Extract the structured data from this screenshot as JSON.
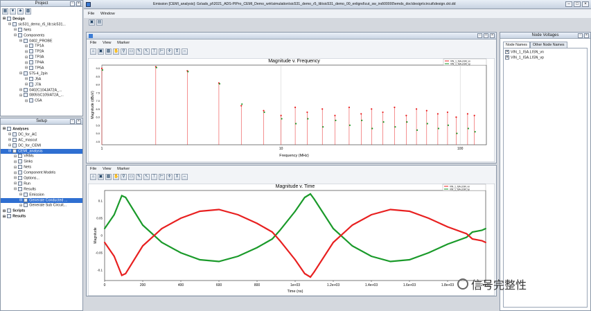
{
  "app": {
    "title": "Emission [CEMI_analysis]: Gs\\ads_pl\\2021_ADS-PIPro_CEMI_Demo_wrk\\simulation\\sic531_demo_r5_lib\\sic531_demo_00_enlignd\\cut_sw_ind\\00000\\emds_doc\\design\\circuit\\design.ckt.dd",
    "menu": [
      "File",
      "Window"
    ]
  },
  "project": {
    "title": "Project",
    "items": [
      {
        "label": "Design",
        "indent": 0,
        "bold": true
      },
      {
        "label": "sic531_demo_r5_lib:sic531...",
        "indent": 1
      },
      {
        "label": "Nets",
        "indent": 2
      },
      {
        "label": "Components",
        "indent": 2
      },
      {
        "label": "0402_PROBE",
        "indent": 3
      },
      {
        "label": "TP1A",
        "indent": 4
      },
      {
        "label": "TP2A",
        "indent": 4
      },
      {
        "label": "TP3A",
        "indent": 4
      },
      {
        "label": "TP4A",
        "indent": 4
      },
      {
        "label": "TP5A",
        "indent": 4
      },
      {
        "label": "575-4_2pin",
        "indent": 3
      },
      {
        "label": "J5A",
        "indent": 4
      },
      {
        "label": "J7A",
        "indent": 4
      },
      {
        "label": "0402C104JAT2A_...",
        "indent": 3
      },
      {
        "label": "0805SC105IAT2A_...",
        "indent": 3
      },
      {
        "label": "C5A",
        "indent": 4
      }
    ]
  },
  "setup": {
    "title": "Setup",
    "items": [
      {
        "label": "Analyses",
        "indent": 0,
        "bold": true
      },
      {
        "label": "DC_for_AC",
        "indent": 1
      },
      {
        "label": "AC_mascut",
        "indent": 1
      },
      {
        "label": "DC_for_CEMI",
        "indent": 1
      },
      {
        "label": "CEMI_analysis",
        "indent": 1,
        "selected": true
      },
      {
        "label": "VRMs",
        "indent": 2
      },
      {
        "label": "Sinks",
        "indent": 2
      },
      {
        "label": "Nets",
        "indent": 2
      },
      {
        "label": "Component Models",
        "indent": 2
      },
      {
        "label": "Options...",
        "indent": 2
      },
      {
        "label": "Run",
        "indent": 2
      },
      {
        "label": "Results",
        "indent": 2
      },
      {
        "label": "Emission",
        "indent": 3
      },
      {
        "label": "Generate Conducted ...",
        "indent": 3,
        "selected": true
      },
      {
        "label": "Generate Sub Circuit...",
        "indent": 3
      },
      {
        "label": "Scripts",
        "indent": 0,
        "bold": true
      },
      {
        "label": "Results",
        "indent": 0,
        "bold": true
      }
    ]
  },
  "plot_menu": [
    "File",
    "View",
    "Marker"
  ],
  "node_voltages": {
    "title": "Node Voltages",
    "tabs": [
      "Node Names",
      "Other Node Names"
    ],
    "items": [
      "VIN_1_ISA.LISN_vn",
      "VIN_1_ISA.LISN_vp"
    ]
  },
  "watermark": "信号完整性",
  "colors": {
    "red": "#e82020",
    "green": "#1a9a2a",
    "select": "#2f6fd1"
  },
  "chart_data": [
    {
      "type": "scatter",
      "title": "Magnitude v. Frequency",
      "xlabel": "Frequency (MHz)",
      "ylabel": "Magnitude (dBuV)",
      "xscale": "log",
      "xticks": [
        "1",
        "10",
        "100"
      ],
      "yticks": [
        "9.0",
        "8.5",
        "8.0",
        "7.5",
        "7.0",
        "6.5",
        "6.0",
        "5.5",
        "5.0",
        "4.5"
      ],
      "ylim": [
        4.3,
        9.2
      ],
      "legend": [
        "VIN_1_ISA.LISN_vn",
        "VIN_1_ISA.LISN_vp"
      ],
      "series": [
        {
          "name": "VIN_1_ISA.LISN_vn",
          "color": "red",
          "x": [
            1,
            2,
            3,
            4.5,
            6,
            8,
            10,
            12,
            14,
            17,
            20,
            24,
            28,
            32,
            37,
            43,
            50,
            57,
            65,
            75,
            85,
            95,
            110,
            120
          ],
          "values": [
            9.0,
            9.1,
            8.85,
            8.1,
            6.7,
            6.4,
            6.1,
            6.6,
            6.3,
            6.5,
            6.1,
            6.6,
            6.2,
            6.5,
            6.3,
            6.6,
            6.1,
            6.5,
            6.4,
            6.2,
            6.3,
            6.0,
            6.2,
            6.1
          ]
        },
        {
          "name": "VIN_1_ISA.LISN_vp",
          "color": "green",
          "x": [
            1,
            2,
            3,
            4.5,
            6,
            8,
            10,
            12,
            14,
            17,
            20,
            24,
            28,
            32,
            37,
            43,
            50,
            57,
            65,
            75,
            85,
            95,
            110,
            120
          ],
          "values": [
            8.9,
            9.05,
            8.8,
            8.05,
            6.8,
            6.3,
            5.9,
            5.6,
            5.9,
            5.4,
            5.8,
            5.5,
            5.8,
            5.3,
            5.7,
            5.4,
            5.7,
            5.2,
            5.6,
            5.3,
            5.5,
            5.0,
            5.3,
            5.1
          ]
        }
      ]
    },
    {
      "type": "line",
      "title": "Magnitude v. Time",
      "xlabel": "Time (ns)",
      "ylabel": "Magnitude",
      "xticks": [
        "0",
        "200",
        "400",
        "600",
        "800",
        "1e+03",
        "1.2e+03",
        "1.4e+03",
        "1.6e+03",
        "1.8e+03",
        "2e+03"
      ],
      "yticks": [
        "0.1",
        "0.05",
        "0",
        "-0.05",
        "-0.1"
      ],
      "xlim": [
        0,
        2000
      ],
      "ylim": [
        -0.13,
        0.13
      ],
      "legend": [
        "VIN_1_ISA.LISN_vn",
        "VIN_1_ISA.LISN_vp"
      ],
      "series": [
        {
          "name": "VIN_1_ISA.LISN_vp",
          "color": "green",
          "x": [
            0,
            50,
            90,
            110,
            200,
            300,
            400,
            500,
            600,
            700,
            800,
            880,
            920,
            1000,
            1050,
            1080,
            1100,
            1200,
            1300,
            1400,
            1500,
            1600,
            1700,
            1800,
            1900,
            1930,
            1980,
            2000
          ],
          "values": [
            0.02,
            0.06,
            0.115,
            0.11,
            0.03,
            -0.02,
            -0.05,
            -0.07,
            -0.075,
            -0.06,
            -0.035,
            -0.01,
            0.015,
            0.07,
            0.11,
            0.12,
            0.105,
            0.02,
            -0.03,
            -0.06,
            -0.075,
            -0.07,
            -0.05,
            -0.025,
            -0.005,
            0.01,
            0.015,
            0.02
          ]
        },
        {
          "name": "VIN_1_ISA.LISN_vn",
          "color": "red",
          "x": [
            0,
            50,
            90,
            110,
            200,
            300,
            400,
            500,
            600,
            700,
            800,
            880,
            920,
            1000,
            1050,
            1080,
            1100,
            1200,
            1300,
            1400,
            1500,
            1600,
            1700,
            1800,
            1900,
            1930,
            1980,
            2000
          ],
          "values": [
            -0.02,
            -0.06,
            -0.115,
            -0.11,
            -0.03,
            0.02,
            0.05,
            0.07,
            0.075,
            0.06,
            0.035,
            0.01,
            -0.015,
            -0.07,
            -0.11,
            -0.12,
            -0.105,
            -0.02,
            0.03,
            0.06,
            0.075,
            0.07,
            0.05,
            0.025,
            0.005,
            -0.01,
            -0.015,
            -0.02
          ]
        }
      ]
    }
  ]
}
